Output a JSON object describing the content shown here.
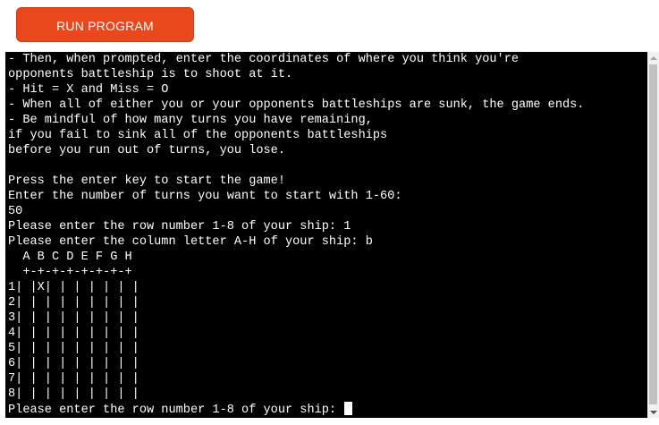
{
  "toolbar": {
    "run_label": "RUN PROGRAM"
  },
  "terminal": {
    "lines": [
      "- Then, when prompted, enter the coordinates of where you think you're",
      "opponents battleship is to shoot at it.",
      "- Hit = X and Miss = O",
      "- When all of either you or your opponents battleships are sunk, the game ends.",
      "- Be mindful of how many turns you have remaining,",
      "if you fail to sink all of the opponents battleships",
      "before you run out of turns, you lose.",
      "",
      "Press the enter key to start the game!",
      "Enter the number of turns you want to start with 1-60:",
      "50",
      "Please enter the row number 1-8 of your ship: 1",
      "Please enter the column letter A-H of your ship: b",
      "  A B C D E F G H",
      "  +-+-+-+-+-+-+-+",
      "1| |X| | | | | | |",
      "2| | | | | | | | |",
      "3| | | | | | | | |",
      "4| | | | | | | | |",
      "5| | | | | | | | |",
      "6| | | | | | | | |",
      "7| | | | | | | | |",
      "8| | | | | | | | |"
    ],
    "prompt": "Please enter the row number 1-8 of your ship: "
  },
  "colors": {
    "button_bg": "#e8481b",
    "terminal_bg": "#000000",
    "terminal_fg": "#ffffff"
  }
}
